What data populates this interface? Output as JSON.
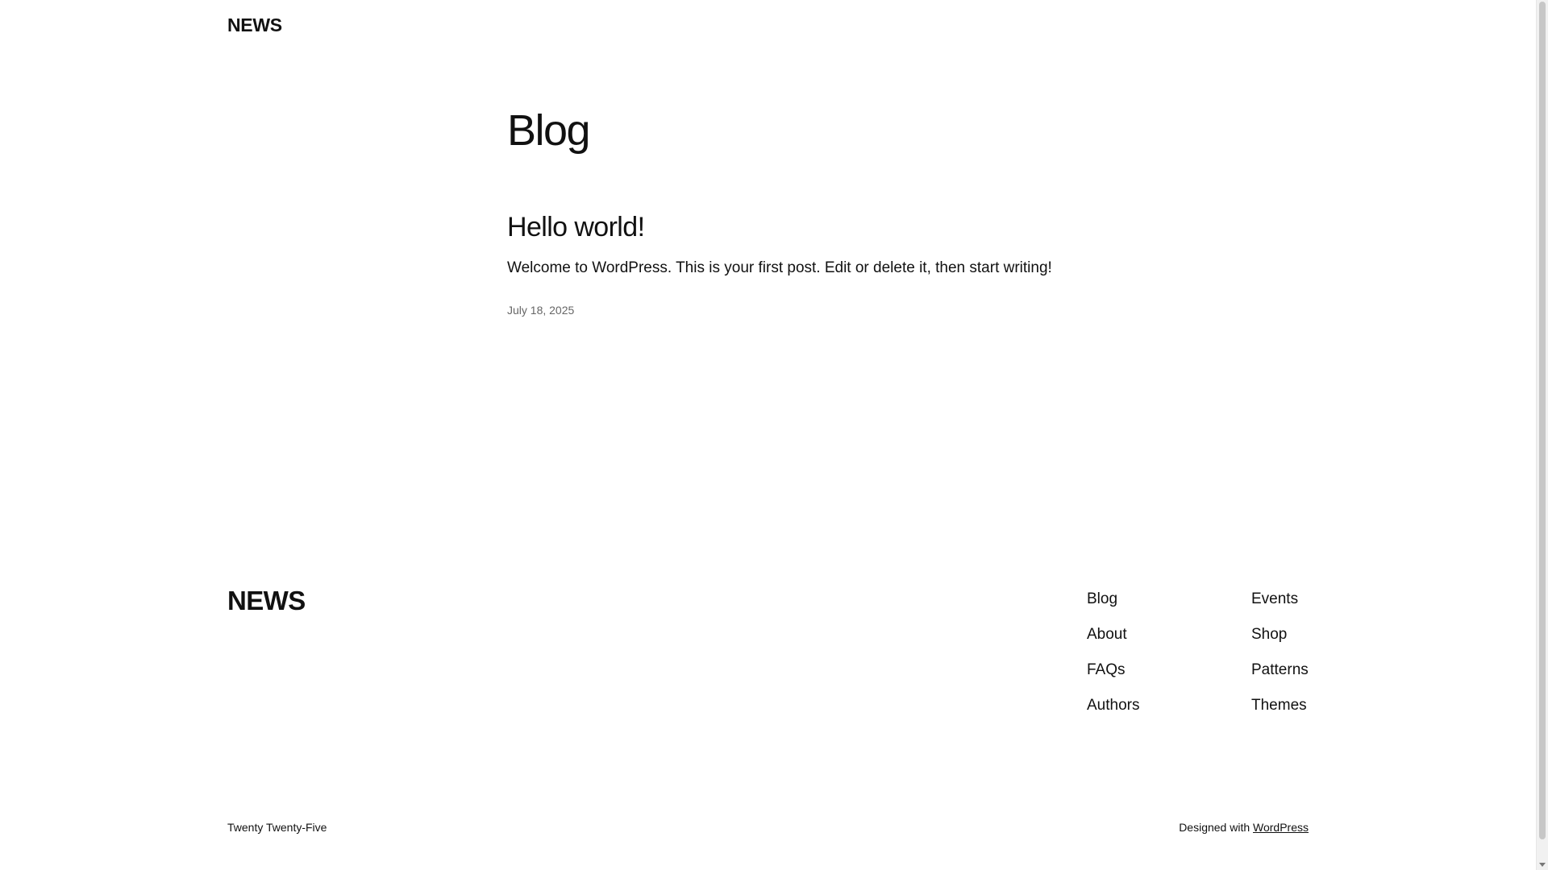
{
  "header": {
    "site_title": "NEWS"
  },
  "main": {
    "heading": "Blog",
    "posts": [
      {
        "title": "Hello world!",
        "excerpt": "Welcome to WordPress. This is your first post. Edit or delete it, then start writing!",
        "date": "July 18, 2025"
      }
    ]
  },
  "footer": {
    "site_title": "NEWS",
    "nav_col1": [
      "Blog",
      "About",
      "FAQs",
      "Authors"
    ],
    "nav_col2": [
      "Events",
      "Shop",
      "Patterns",
      "Themes"
    ],
    "theme_name": "Twenty Twenty-Five",
    "designed_with_text": "Designed with",
    "wordpress_link": "WordPress"
  },
  "colors": {
    "background": "#ffffff",
    "text": "#111111",
    "muted": "#666666"
  }
}
